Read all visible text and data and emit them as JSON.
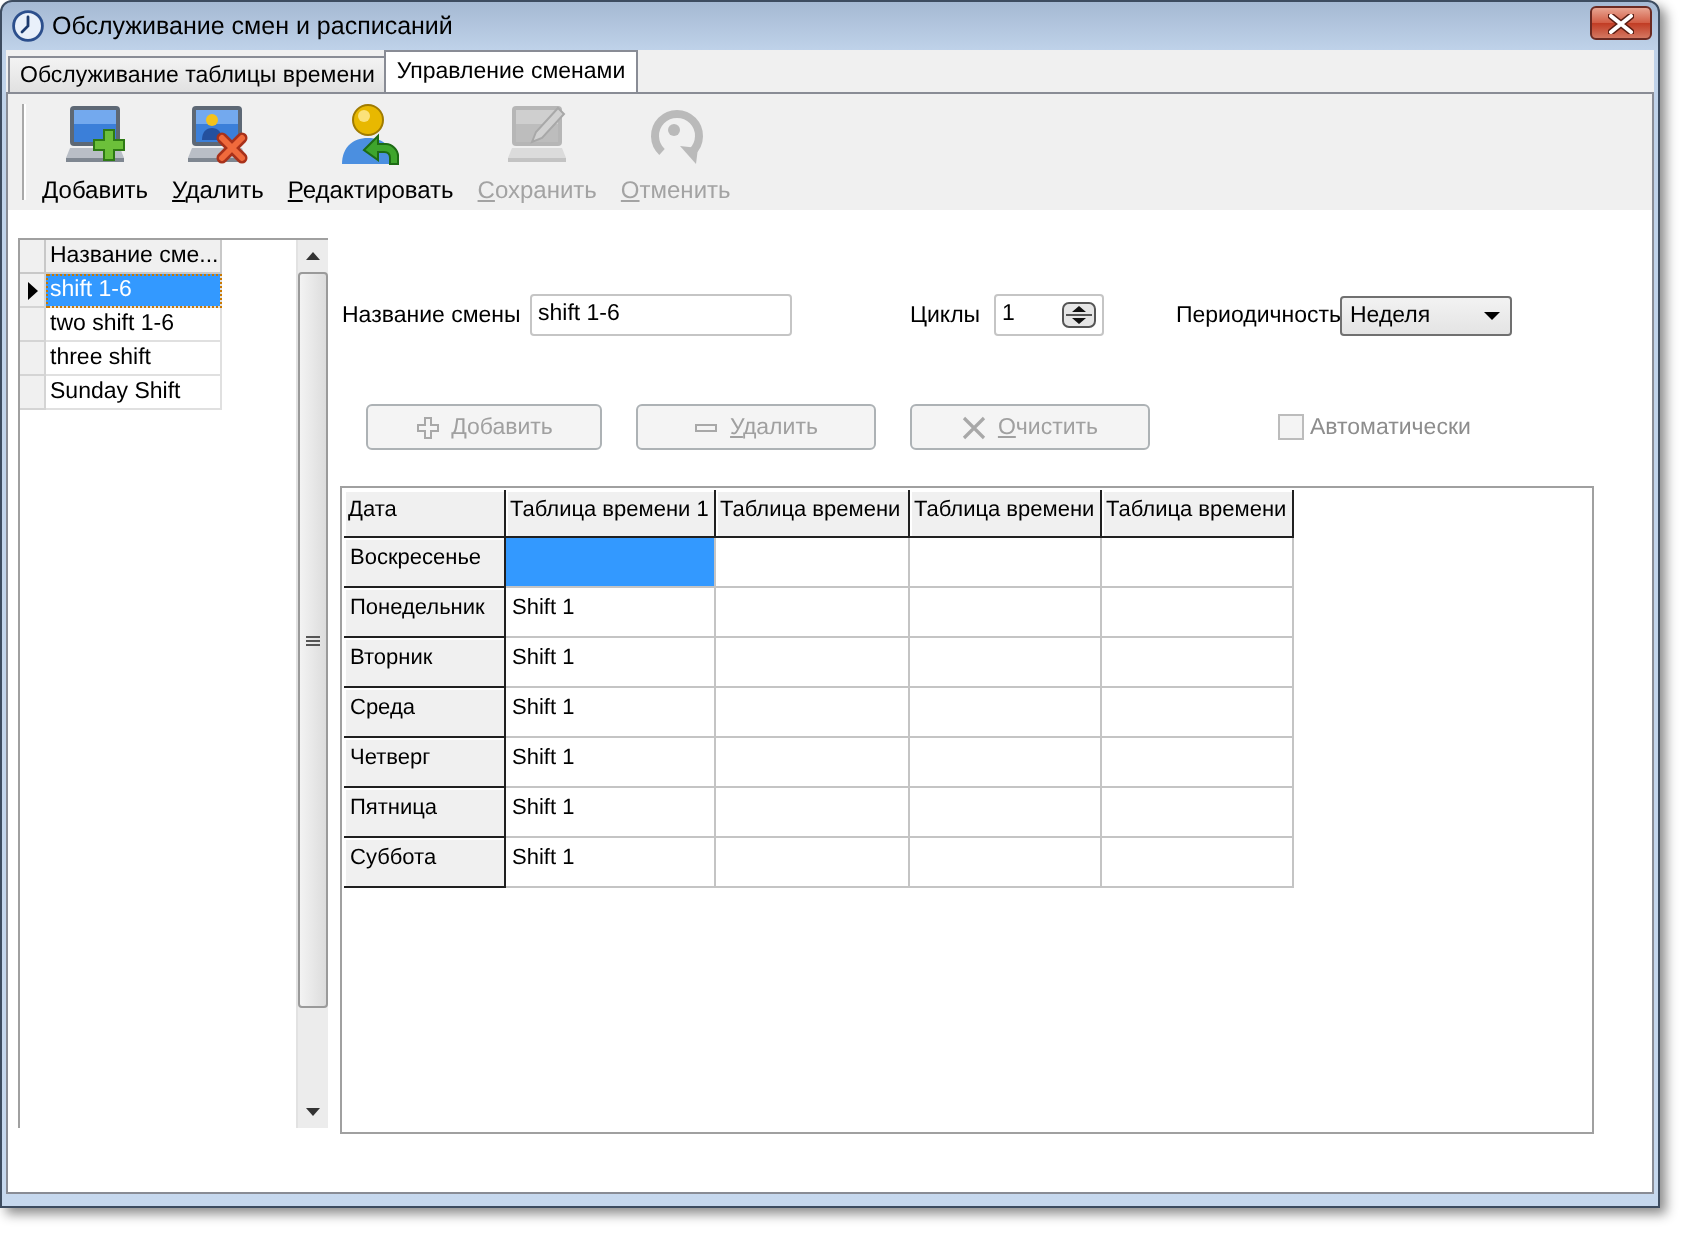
{
  "window": {
    "title": "Обслуживание смен и расписаний"
  },
  "tabs": [
    {
      "label": "Обслуживание таблицы времени",
      "selected": false
    },
    {
      "label": "Управление сменами",
      "selected": true
    }
  ],
  "toolbar": [
    {
      "kind": "add",
      "label": "Добавить",
      "disabled": false
    },
    {
      "kind": "delete",
      "label": "Удалить",
      "disabled": false
    },
    {
      "kind": "edit",
      "label": "Редактировать",
      "disabled": false
    },
    {
      "kind": "save",
      "label": "Сохранить",
      "disabled": true
    },
    {
      "kind": "cancel",
      "label": "Отменить",
      "disabled": true
    }
  ],
  "shift_list": {
    "column": "Название сме...",
    "rows": [
      {
        "name": "shift 1-6",
        "selected": true
      },
      {
        "name": "two shift 1-6",
        "selected": false
      },
      {
        "name": "three shift",
        "selected": false
      },
      {
        "name": "Sunday Shift",
        "selected": false
      }
    ]
  },
  "form": {
    "name": {
      "label": "Название смены",
      "value": "shift 1-6"
    },
    "cycles": {
      "label": "Циклы",
      "value": "1"
    },
    "period": {
      "label": "Периодичность",
      "value": "Неделя"
    }
  },
  "actions": [
    {
      "kind": "add",
      "label": "Добавить",
      "disabled": true
    },
    {
      "kind": "remove",
      "label": "Удалить",
      "disabled": true
    },
    {
      "kind": "clear",
      "label": "Очистить",
      "disabled": true
    }
  ],
  "auto": {
    "label": "Автоматически",
    "checked": false,
    "disabled": true
  },
  "schedule": {
    "columns": [
      "Дата",
      "Таблица времени 1",
      "Таблица времени",
      "Таблица времени",
      "Таблица времени"
    ],
    "rows": [
      {
        "day": "Воскресенье",
        "cells": [
          {
            "selected": true
          },
          {
            "selected": false
          },
          {
            "selected": false
          },
          {
            "selected": false
          }
        ]
      },
      {
        "day": "Понедельник",
        "cells": [
          {
            "text": "Shift 1",
            "selected": false
          },
          {
            "selected": false
          },
          {
            "selected": false
          },
          {
            "selected": false
          }
        ]
      },
      {
        "day": "Вторник",
        "cells": [
          {
            "text": "Shift 1",
            "selected": false
          },
          {
            "selected": false
          },
          {
            "selected": false
          },
          {
            "selected": false
          }
        ]
      },
      {
        "day": "Среда",
        "cells": [
          {
            "text": "Shift 1",
            "selected": false
          },
          {
            "selected": false
          },
          {
            "selected": false
          },
          {
            "selected": false
          }
        ]
      },
      {
        "day": "Четверг",
        "cells": [
          {
            "text": "Shift 1",
            "selected": false
          },
          {
            "selected": false
          },
          {
            "selected": false
          },
          {
            "selected": false
          }
        ]
      },
      {
        "day": "Пятница",
        "cells": [
          {
            "text": "Shift 1",
            "selected": false
          },
          {
            "selected": false
          },
          {
            "selected": false
          },
          {
            "selected": false
          }
        ]
      },
      {
        "day": "Суббота",
        "cells": [
          {
            "text": "Shift 1",
            "selected": false
          },
          {
            "selected": false
          },
          {
            "selected": false
          },
          {
            "selected": false
          }
        ]
      }
    ]
  }
}
